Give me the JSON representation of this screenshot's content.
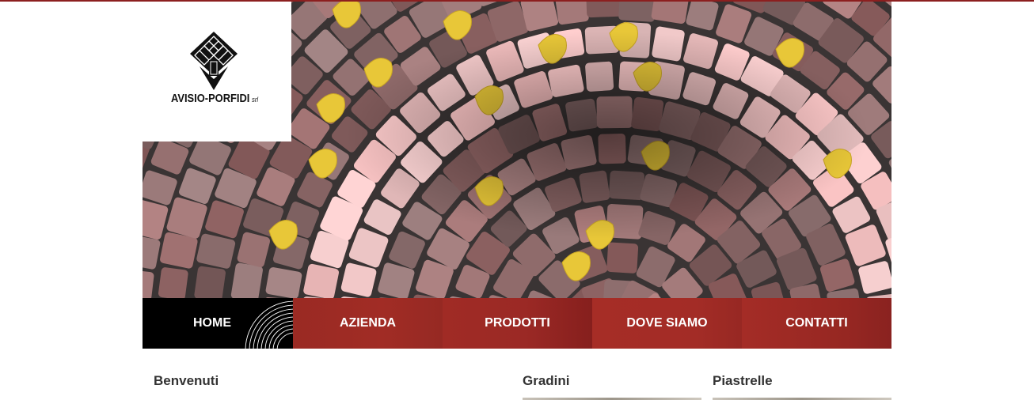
{
  "brand": {
    "logo_text": "AVISIO-PORFIDI",
    "logo_suffix": "srl",
    "accent_color": "#9b2a24",
    "top_line_color": "#8c1f1f"
  },
  "banner": {
    "image_subject": "porphyry cobblestone pavement with yellow ginkgo leaves"
  },
  "nav": {
    "items": [
      {
        "label": "HOME",
        "active": true
      },
      {
        "label": "AZIENDA"
      },
      {
        "label": "PRODOTTI"
      },
      {
        "label": "DOVE SIAMO"
      },
      {
        "label": "CONTATTI"
      }
    ]
  },
  "content": {
    "welcome_heading": "Benvenuti",
    "col2_heading": "Gradini",
    "col3_heading": "Piastrelle"
  },
  "icons": {
    "logo": "cube-stack-logo-icon",
    "home_decoration": "concentric-arcs-icon"
  }
}
